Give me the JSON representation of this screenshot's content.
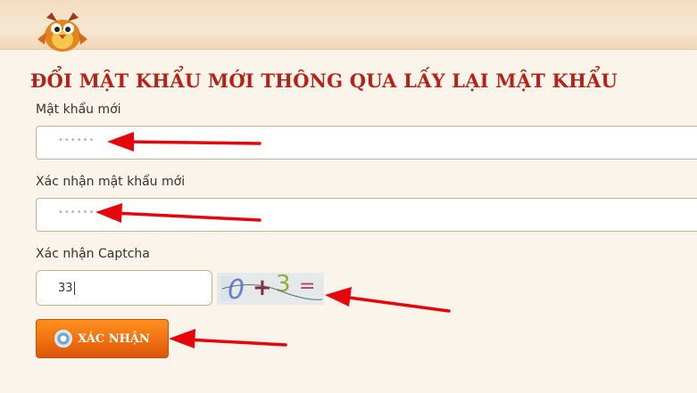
{
  "form": {
    "title": "ĐỔI MẬT KHẨU MỚI THÔNG QUA LẤY LẠI MẬT KHẨU",
    "new_password": {
      "label": "Mật khẩu mới",
      "masked_value": "••••••"
    },
    "confirm_password": {
      "label": "Xác nhận mật khẩu mới",
      "masked_value": "••••••"
    },
    "captcha": {
      "label": "Xác nhận Captcha",
      "value": "33",
      "image_chars": [
        "0",
        "+",
        "3",
        "="
      ]
    },
    "submit_label": "XÁC NHẬN"
  },
  "colors": {
    "title": "#b62216",
    "button": "#f07010",
    "annotation_arrow": "#e5050a"
  },
  "icons": {
    "mascot": "cartoon-bird-mascot",
    "button": "gear-icon"
  }
}
